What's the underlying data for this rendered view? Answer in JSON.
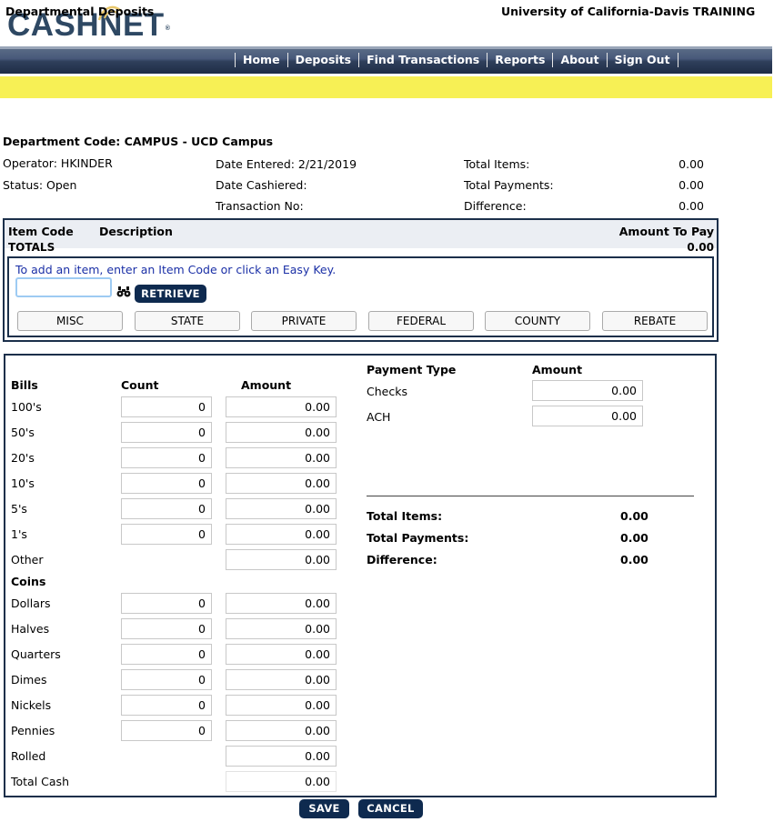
{
  "brand": {
    "logo_text": "CASHNET",
    "registered_mark": "®"
  },
  "nav": {
    "items": [
      "Home",
      "Deposits",
      "Find Transactions",
      "Reports",
      "About",
      "Sign Out"
    ]
  },
  "subbar": {
    "title": "Departmental Deposits",
    "org": "University of California-Davis TRAINING"
  },
  "header": {
    "department": "Department Code: CAMPUS - UCD Campus",
    "operator": "Operator: HKINDER",
    "status": "Status: Open",
    "date_entered": "Date Entered: 2/21/2019",
    "date_cashiered": "Date Cashiered:",
    "transaction_no": "Transaction No:",
    "summary": [
      {
        "label": "Total Items:",
        "value": "0.00"
      },
      {
        "label": "Total Payments:",
        "value": "0.00"
      },
      {
        "label": "Difference:",
        "value": "0.00"
      }
    ]
  },
  "items": {
    "col_item_code": "Item Code",
    "col_description": "Description",
    "col_amount": "Amount To Pay",
    "totals_label": "TOTALS",
    "totals_value": "0.00",
    "hint": "To add an item, enter an Item Code or click an Easy Key.",
    "item_code_value": "",
    "retrieve_label": "RETRIEVE",
    "easy_keys": [
      "MISC",
      "STATE",
      "PRIVATE",
      "FEDERAL",
      "COUNTY",
      "REBATE"
    ]
  },
  "cash": {
    "bills_heading": "Bills",
    "count_heading": "Count",
    "amount_heading": "Amount",
    "coins_heading": "Coins",
    "bills": [
      {
        "label": "100's",
        "count": "0",
        "amount": "0.00"
      },
      {
        "label": "50's",
        "count": "0",
        "amount": "0.00"
      },
      {
        "label": "20's",
        "count": "0",
        "amount": "0.00"
      },
      {
        "label": "10's",
        "count": "0",
        "amount": "0.00"
      },
      {
        "label": "5's",
        "count": "0",
        "amount": "0.00"
      },
      {
        "label": "1's",
        "count": "0",
        "amount": "0.00"
      },
      {
        "label": "Other",
        "amount": "0.00"
      }
    ],
    "coins": [
      {
        "label": "Dollars",
        "count": "0",
        "amount": "0.00"
      },
      {
        "label": "Halves",
        "count": "0",
        "amount": "0.00"
      },
      {
        "label": "Quarters",
        "count": "0",
        "amount": "0.00"
      },
      {
        "label": "Dimes",
        "count": "0",
        "amount": "0.00"
      },
      {
        "label": "Nickels",
        "count": "0",
        "amount": "0.00"
      },
      {
        "label": "Pennies",
        "count": "0",
        "amount": "0.00"
      },
      {
        "label": "Rolled",
        "amount": "0.00"
      },
      {
        "label": "Total Cash",
        "amount": "0.00"
      }
    ]
  },
  "payments": {
    "type_heading": "Payment Type",
    "amount_heading": "Amount",
    "rows": [
      {
        "label": "Checks",
        "amount": "0.00"
      },
      {
        "label": "ACH",
        "amount": "0.00"
      }
    ],
    "totals": [
      {
        "label": "Total Items:",
        "value": "0.00"
      },
      {
        "label": "Total Payments:",
        "value": "0.00"
      },
      {
        "label": "Difference:",
        "value": "0.00"
      }
    ]
  },
  "actions": {
    "save_label": "SAVE",
    "cancel_label": "CANCEL"
  },
  "colors": {
    "navy": "#0e2a4f",
    "yellow_bar": "#f7f055",
    "link_blue": "#1a2fa6",
    "logo": "#2e4863"
  }
}
